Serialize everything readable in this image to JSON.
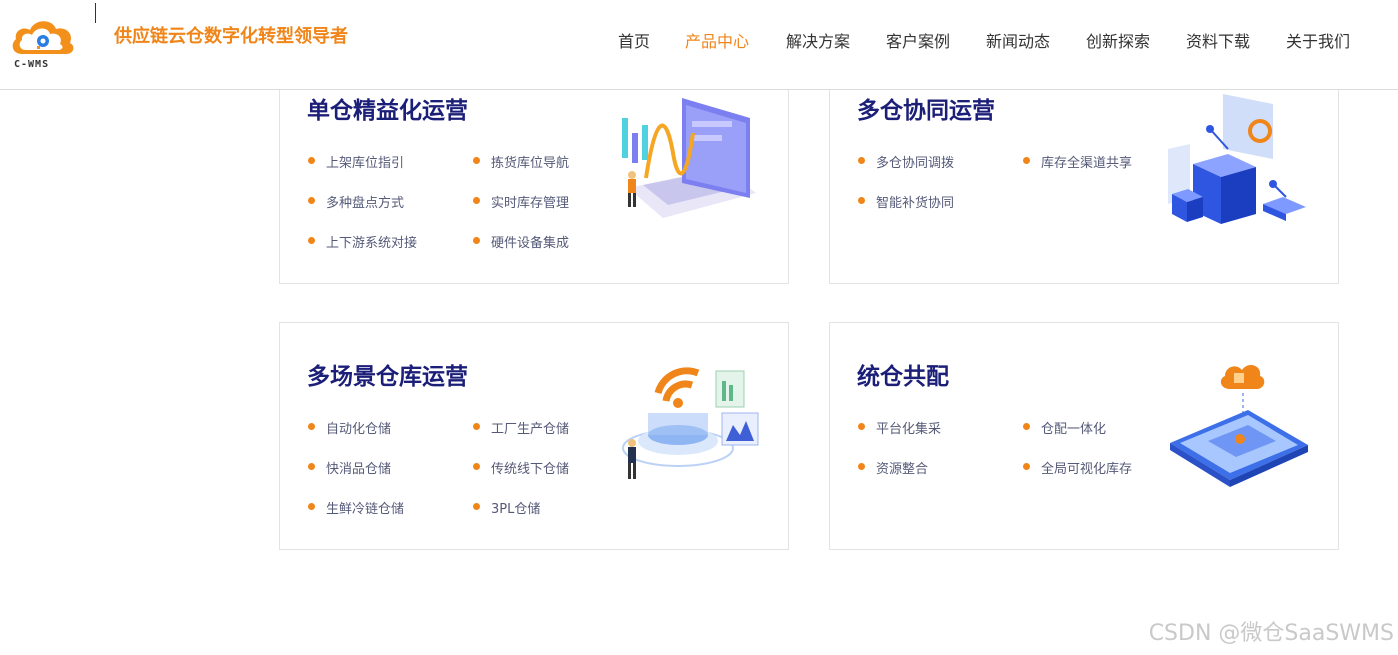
{
  "header": {
    "logo_text": "C-WMS",
    "slogan": "供应链云仓数字化转型领导者",
    "nav": [
      {
        "label": "首页",
        "active": false
      },
      {
        "label": "产品中心",
        "active": true
      },
      {
        "label": "解决方案",
        "active": false
      },
      {
        "label": "客户案例",
        "active": false
      },
      {
        "label": "新闻动态",
        "active": false
      },
      {
        "label": "创新探索",
        "active": false
      },
      {
        "label": "资料下载",
        "active": false
      },
      {
        "label": "关于我们",
        "active": false
      }
    ]
  },
  "cards": [
    {
      "title": "单仓精益化运营",
      "features": [
        "上架库位指引",
        "拣货库位导航",
        "多种盘点方式",
        "实时库存管理",
        "上下游系统对接",
        "硬件设备集成"
      ],
      "icon": "laptop-chart-illustration"
    },
    {
      "title": "多仓协同运营",
      "features": [
        "多仓协同调拨",
        "库存全渠道共享",
        "智能补货协同"
      ],
      "icon": "cube-network-illustration"
    },
    {
      "title": "多场景仓库运营",
      "features": [
        "自动化仓储",
        "工厂生产仓储",
        "快消品仓储",
        "传统线下仓储",
        "生鲜冷链仓储",
        "3PL仓储"
      ],
      "icon": "wifi-platform-illustration"
    },
    {
      "title": "统仓共配",
      "features": [
        "平台化集采",
        "仓配一体化",
        "资源整合",
        "全局可视化库存"
      ],
      "icon": "cloud-tablet-illustration"
    }
  ],
  "watermark": "CSDN @微仓SaaSWMS",
  "colors": {
    "accent": "#f08519",
    "title": "#1c1f78",
    "text": "#555a78"
  }
}
